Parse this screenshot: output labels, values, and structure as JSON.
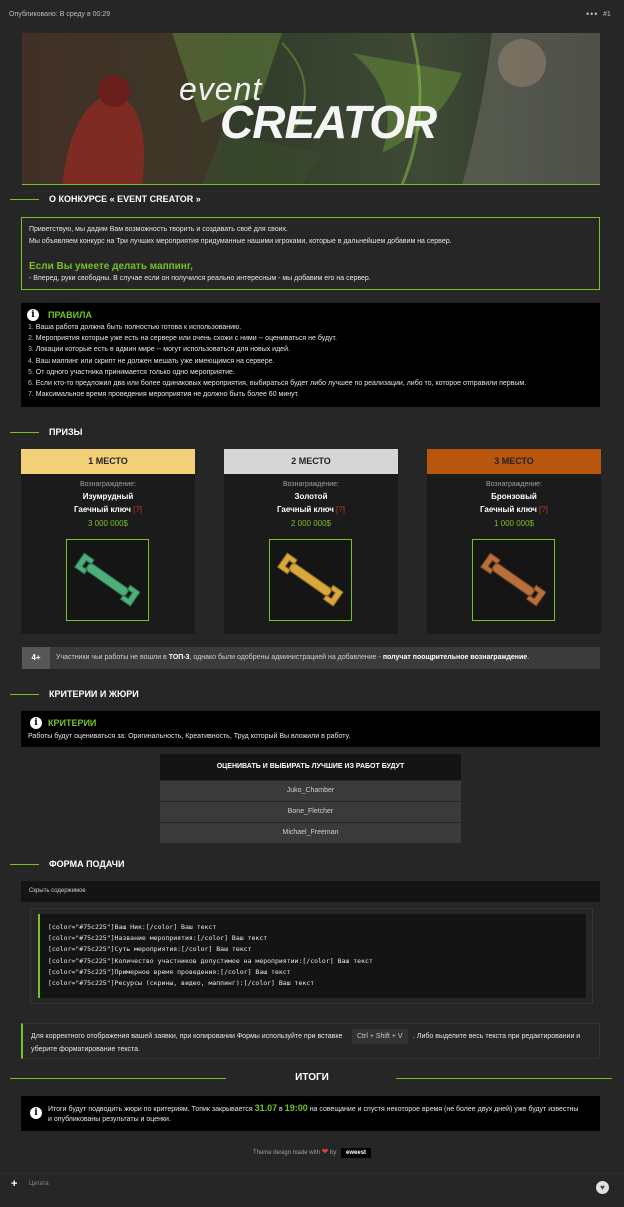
{
  "topbar": {
    "published": "Опубликовано: В среду в 00:29",
    "menu": "•••",
    "post_number": "#1"
  },
  "banner": {
    "line1": "event",
    "line2": "CREATOR"
  },
  "sections": {
    "about": "О КОНКУРСЕ « EVENT CREATOR »",
    "prizes": "ПРИЗЫ",
    "criteria": "КРИТЕРИИ И ЖЮРИ",
    "form": "ФОРМА ПОДАЧИ",
    "results": "ИТОГИ"
  },
  "intro": {
    "line1": "Приветствую, мы дадим Вам возможность творить и создавать своё для своих.",
    "line2": "Мы объявляем конкурс на Три лучших мероприятия придуманные нашими игроками, которые в дальнейшем добавим на сервер.",
    "heading": "Если Вы умеете делать маппинг,",
    "line3": "- Вперед, руки свободны. В случае если он получился реально интересным - мы добавим его на сервер."
  },
  "rules": {
    "title": "ПРАВИЛА",
    "items": [
      {
        "n": "1.",
        "text": "Ваша работа должна быть полностью готова к использованию."
      },
      {
        "n": "2.",
        "text": "Мероприятия которые уже есть на сервере или очень схожи с ними -- оцениваться не будут."
      },
      {
        "n": "3.",
        "text": "Локации которые есть в админ мире -- могут использоваться для новых идей."
      },
      {
        "n": "4.",
        "text": "Ваш маппинг или скрипт не должен мешать уже имеющимся на сервере."
      },
      {
        "n": "5.",
        "text": "От одного участника принимается только одно мероприятие."
      },
      {
        "n": "6.",
        "text": "Если кто-то предложил два или более одинаковых мероприятия, выбираться будет либо лучшее по реализации, либо то, которое отправили первым."
      },
      {
        "n": "7.",
        "text": "Максимальное время проведения мероприятия не должно быть более 60 минут."
      }
    ]
  },
  "prizes": [
    {
      "place": "1 МЕСТО",
      "reward_label": "Вознаграждение:",
      "name1": "Изумрудный",
      "name2": "Гаечный ключ",
      "mark": "[?]",
      "amount": "3 000 000$",
      "head_color": "#f2d078",
      "wrench_color": "#4caf7a"
    },
    {
      "place": "2 МЕСТО",
      "reward_label": "Вознаграждение:",
      "name1": "Золотой",
      "name2": "Гаечный ключ",
      "mark": "[?]",
      "amount": "2 000 000$",
      "head_color": "#d6d6d6",
      "wrench_color": "#d9a83a"
    },
    {
      "place": "3 МЕСТО",
      "reward_label": "Вознаграждение:",
      "name1": "Бронзовый",
      "name2": "Гаечный ключ",
      "mark": "[?]",
      "amount": "1 000 000$",
      "head_color": "#b8560e",
      "wrench_color": "#b86f3c"
    }
  ],
  "extra_prize": {
    "badge": "4+",
    "text_a": "Участники чьи работы не вошли в ",
    "text_b": "ТОП-3",
    "text_c": ", однако были одобрены администрацией на добавление - ",
    "text_d": "получат поощрительное вознаграждение",
    "text_e": "."
  },
  "criteria": {
    "title": "КРИТЕРИИ",
    "text": "Работы будут оцениваться за: Оригинальность, Креативность, Труд который Вы вложили в работу."
  },
  "jury": {
    "heading": "ОЦЕНИВАТЬ И ВЫБИРАТЬ ЛУЧШИЕ ИЗ РАБОТ БУДУТ",
    "members": [
      "Juko_Chamber",
      "Bone_Fletcher",
      "Michael_Freeman"
    ]
  },
  "form": {
    "spoiler_label": "Скрыть содержимое",
    "code_lines": [
      "[color=\"#75c225\"]Ваш Ник:[/color] Ваш текст",
      "[color=\"#75c225\"]Название мероприятия:[/color] Ваш текст",
      "[color=\"#75c225\"]Суть мероприятия:[/color] Ваш текст",
      "[color=\"#75c225\"]Количество участников допустимое на мероприятии:[/color] Ваш текст",
      "[color=\"#75c225\"]Примерное время проведения:[/color] Ваш текст",
      "[color=\"#75c225\"]Ресурсы (скрины, видео, маппинг):[/color] Ваш текст"
    ],
    "note_a": "Для корректного отображения вашей заявки, при копировании Формы используйте при вставке",
    "note_kbd": "Ctrl + Shift + V",
    "note_b": ". Либо выделите весь текста при редактировании и",
    "note_c": "уберите форматирование текста."
  },
  "results": {
    "text_a": "Итоги будут подводить жюри по критериям. Топик закрывается ",
    "date": "31.07",
    "text_b": " в ",
    "time": "19:00",
    "text_c": " на совещание и спустя некоторое время (не более двух дней) уже будут известны",
    "line2": "и опубликованы результаты и оценки."
  },
  "footer": {
    "text_a": "Theme design made with",
    "text_b": "by",
    "brand": "eweest"
  },
  "bottom": {
    "plus": "+",
    "quote": "Цитата"
  },
  "colors": {
    "accent": "#75c225"
  }
}
